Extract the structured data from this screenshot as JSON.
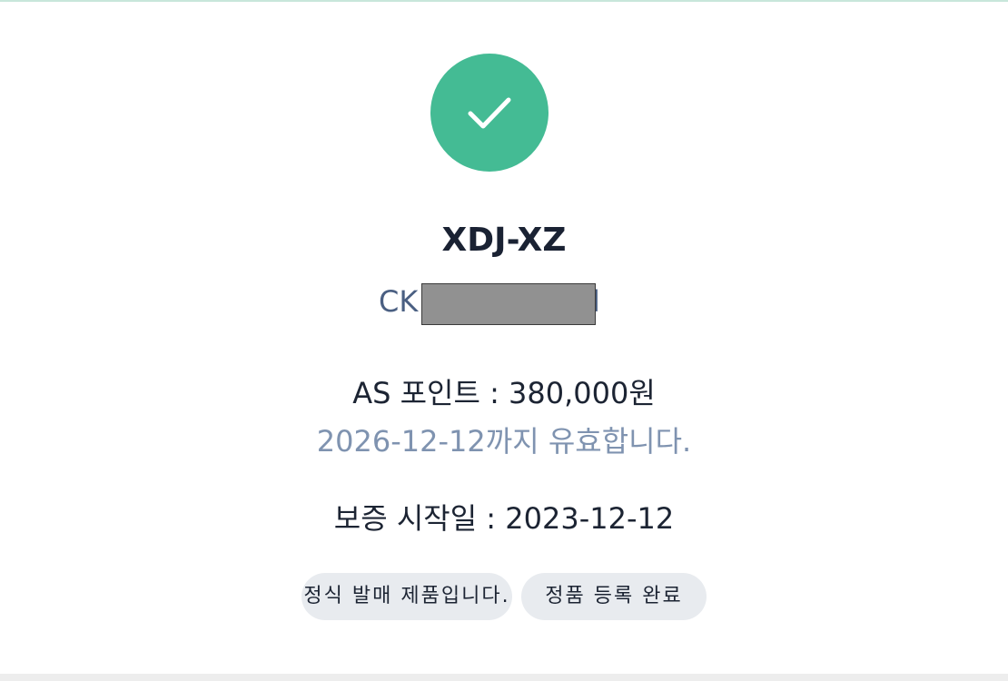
{
  "status": {
    "icon": "check-icon",
    "accent_color": "#44bb94"
  },
  "product": {
    "name": "XDJ-XZ",
    "serial_prefix": "CK",
    "serial_tail": "l"
  },
  "as_point": {
    "text": "AS 포인트 : 380,000원",
    "validity": "2026-12-12까지 유효합니다."
  },
  "warranty": {
    "text": "보증 시작일 : 2023-12-12"
  },
  "badges": [
    {
      "label": "정식 발매 제품입니다."
    },
    {
      "label": "정품 등록 완료"
    }
  ]
}
